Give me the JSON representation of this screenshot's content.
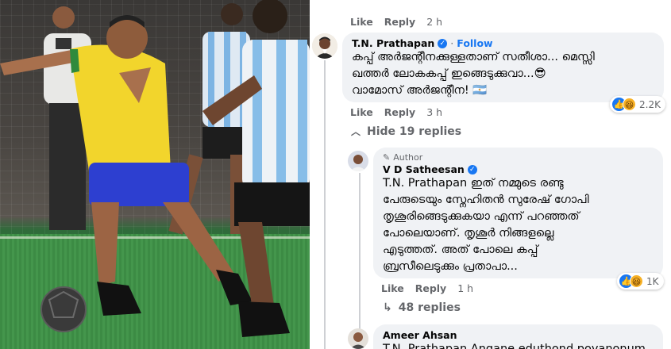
{
  "top_meta": {
    "like": "Like",
    "reply": "Reply",
    "time": "2 h"
  },
  "comment1": {
    "author": "T.N. Prathapan",
    "follow": "Follow",
    "text_lines": [
      "കപ്പ് അർജന്റീനക്കുള്ളതാണ് സതീശാ... മെസ്സി",
      "ഖത്തർ ലോകകപ്പ് ഇങ്ങെടുക്കുവാ...😎",
      "വാമോസ് അർജന്റീന! 🇦🇷"
    ],
    "like": "Like",
    "reply": "Reply",
    "time": "3 h",
    "reactions": "2.2K"
  },
  "hide_replies": "Hide 19 replies",
  "comment2": {
    "badge": "Author",
    "author": "V D Satheesan",
    "text_lines": [
      "T.N. Prathapan ഇത് നമ്മുടെ രണ്ടു",
      "പേരുടെയും സ്നേഹിതൻ സുരേഷ് ഗോപി",
      "തൃശൂരിങ്ങെടുക്കുകയാ എന്ന് പറഞ്ഞത്",
      "പോലെയാണ്. തൃശൂർ നിങ്ങളല്ലെ",
      "എടുത്തത്. അത് പോലെ കപ്പ്",
      "ബ്രസീലെടുക്കും പ്രതാപാ..."
    ],
    "like": "Like",
    "reply": "Reply",
    "time": "1 h",
    "reactions": "1K"
  },
  "more_replies": "48 replies",
  "comment3": {
    "author": "Ameer Ahsan",
    "text_partial": "T.N. Prathapan Angane eduthond povanonum"
  },
  "icons": {
    "verified": "verified-badge-icon",
    "hide": "chevron-up-icon",
    "replies": "reply-arrow-icon",
    "author": "pencil-icon"
  },
  "colors": {
    "link": "#1877f2",
    "bubble": "#f0f2f5",
    "meta": "#65676b"
  }
}
